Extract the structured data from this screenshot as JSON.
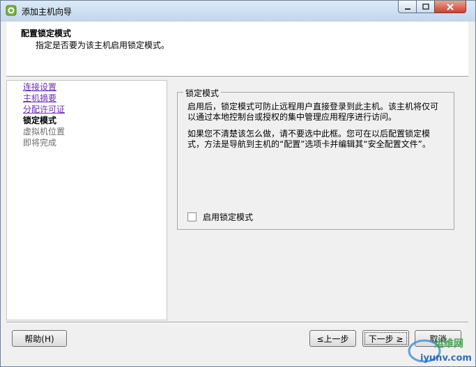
{
  "window": {
    "title": "添加主机向导"
  },
  "header": {
    "title": "配置锁定模式",
    "subtitle": "指定是否要为该主机启用锁定模式。"
  },
  "nav": {
    "items": [
      {
        "label": "连接设置",
        "state": "link"
      },
      {
        "label": "主机摘要",
        "state": "link"
      },
      {
        "label": "分配许可证",
        "state": "link"
      },
      {
        "label": "锁定模式",
        "state": "current"
      },
      {
        "label": "虚拟机位置",
        "state": "disabled"
      },
      {
        "label": "即将完成",
        "state": "disabled"
      }
    ]
  },
  "content": {
    "group_label": "锁定模式",
    "para1_line1": "启用后，锁定模式可防止远程用户直接登录到此主机。该主机将仅可",
    "para1_line2": "以通过本地控制台或授权的集中管理应用程序进行访问。",
    "para2_line1": "如果您不清楚该怎么做，请不要选中此框。您可在以后配置锁定模",
    "para2_line2": "式，方法是导航到主机的“配置”选项卡并编辑其“安全配置文件”。",
    "checkbox_label": "启用锁定模式",
    "checkbox_checked": false
  },
  "buttons": {
    "help": "帮助(H)",
    "back": "≤上一步",
    "next": "下一步 ≥",
    "cancel": "取消"
  },
  "watermark": {
    "top": "运维网",
    "bottom": "iyunv.com"
  },
  "colors": {
    "link": "#6a2fb4",
    "titlebar": "#c9dbee",
    "close": "#c7432c"
  }
}
